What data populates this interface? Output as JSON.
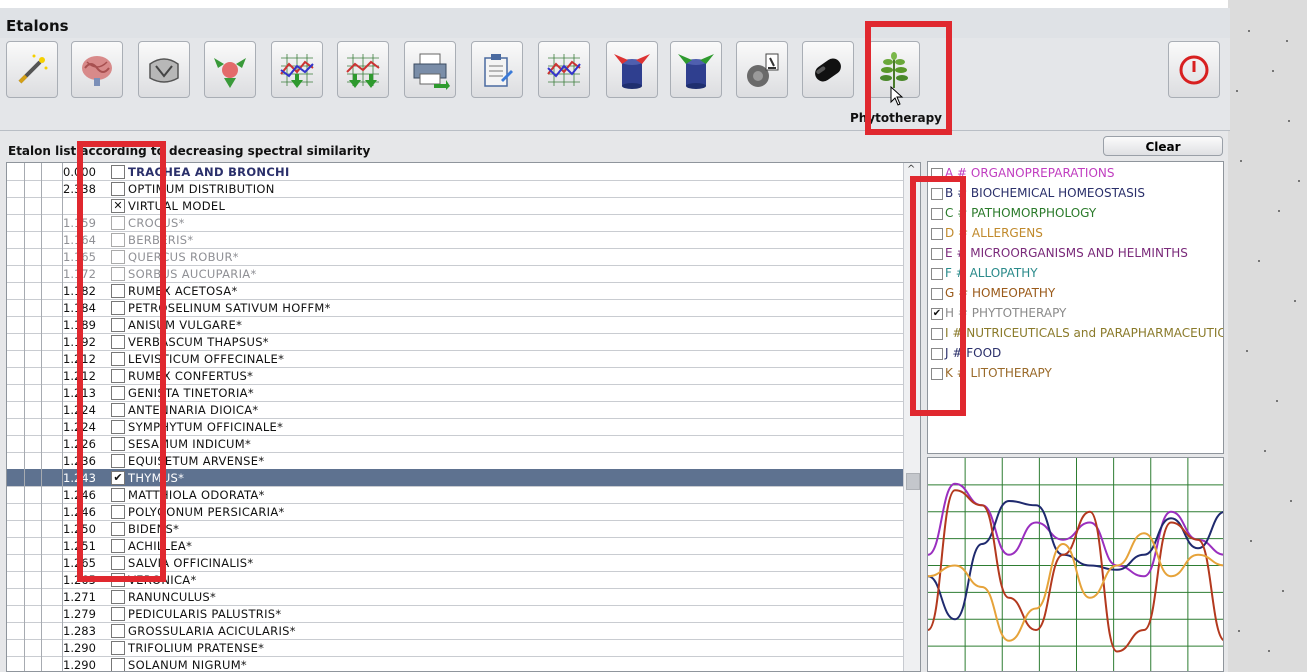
{
  "window": {
    "title": "Etalons"
  },
  "toolbar": {
    "buttons": [
      {
        "icon": "magic-wand-icon"
      },
      {
        "icon": "brain-icon"
      },
      {
        "icon": "torso-icon"
      },
      {
        "icon": "merge-arrows-icon"
      },
      {
        "icon": "chart-up-icon"
      },
      {
        "icon": "chart-double-up-icon"
      },
      {
        "icon": "printer-icon"
      },
      {
        "icon": "clipboard-icon"
      },
      {
        "icon": "spectrum-chart-icon"
      },
      {
        "icon": "red-cylinder-icon"
      },
      {
        "icon": "green-cylinder-icon"
      },
      {
        "icon": "microscope-icon"
      },
      {
        "icon": "black-capsule-icon"
      },
      {
        "icon": "plant-icon"
      }
    ],
    "phytotherapy_label": "Phytotherapy",
    "power_icon": "power-icon"
  },
  "list": {
    "header": "Etalon list according to decreasing spectral similarity",
    "rows": [
      {
        "value": "0.000",
        "name": "TRACHEA AND BRONCHI",
        "checked": false,
        "style": "first"
      },
      {
        "value": "2.338",
        "name": "OPTIMUM DISTRIBUTION",
        "checked": false,
        "style": "normal"
      },
      {
        "value": "",
        "name": "VIRTUAL MODEL",
        "checked": true,
        "mark": "✕",
        "style": "normal"
      },
      {
        "value": "1.159",
        "name": "CROCUS*",
        "checked": false,
        "style": "grey"
      },
      {
        "value": "1.164",
        "name": "BERBERIS*",
        "checked": false,
        "style": "grey"
      },
      {
        "value": "1.165",
        "name": "QUERCUS ROBUR*",
        "checked": false,
        "style": "grey"
      },
      {
        "value": "1.172",
        "name": "SORBUS AUCUPARIA*",
        "checked": false,
        "style": "grey"
      },
      {
        "value": "1.182",
        "name": "RUMEX ACETOSA*",
        "checked": false,
        "style": "normal"
      },
      {
        "value": "1.184",
        "name": "PETROSELINUM SATIVUM HOFFM*",
        "checked": false,
        "style": "normal"
      },
      {
        "value": "1.189",
        "name": "ANISUM VULGARE*",
        "checked": false,
        "style": "normal"
      },
      {
        "value": "1.192",
        "name": "VERBASCUM THAPSUS*",
        "checked": false,
        "style": "normal"
      },
      {
        "value": "1.212",
        "name": "LEVISTICUM OFFECINALE*",
        "checked": false,
        "style": "normal"
      },
      {
        "value": "1.212",
        "name": "RUMEX CONFERTUS*",
        "checked": false,
        "style": "normal"
      },
      {
        "value": "1.213",
        "name": "GENISTA TINETORIA*",
        "checked": false,
        "style": "normal"
      },
      {
        "value": "1.224",
        "name": "ANTENNARIA DIOICA*",
        "checked": false,
        "style": "normal"
      },
      {
        "value": "1.224",
        "name": "SYMPHYTUM OFFICINALE*",
        "checked": false,
        "style": "normal"
      },
      {
        "value": "1.226",
        "name": "SESAMUM INDICUM*",
        "checked": false,
        "style": "normal"
      },
      {
        "value": "1.236",
        "name": "EQUISETUM ARVENSE*",
        "checked": false,
        "style": "normal"
      },
      {
        "value": "1.243",
        "name": "THYMUS*",
        "checked": true,
        "mark": "✔",
        "style": "selected"
      },
      {
        "value": "1.246",
        "name": "MATTHIOLA ODORATA*",
        "checked": false,
        "style": "normal"
      },
      {
        "value": "1.246",
        "name": "POLYGONUM PERSICARIA*",
        "checked": false,
        "style": "normal"
      },
      {
        "value": "1.250",
        "name": "BIDENS*",
        "checked": false,
        "style": "normal"
      },
      {
        "value": "1.251",
        "name": "ACHILLEA*",
        "checked": false,
        "style": "normal"
      },
      {
        "value": "1.265",
        "name": "SALVIA OFFICINALIS*",
        "checked": false,
        "style": "normal"
      },
      {
        "value": "1.265",
        "name": "VERONICA*",
        "checked": false,
        "style": "normal"
      },
      {
        "value": "1.271",
        "name": "RANUNCULUS*",
        "checked": false,
        "style": "normal"
      },
      {
        "value": "1.279",
        "name": "PEDICULARIS PALUSTRIS*",
        "checked": false,
        "style": "normal"
      },
      {
        "value": "1.283",
        "name": "GROSSULARIA ACICULARIS*",
        "checked": false,
        "style": "normal"
      },
      {
        "value": "1.290",
        "name": "TRIFOLIUM PRATENSE*",
        "checked": false,
        "style": "normal"
      },
      {
        "value": "1.290",
        "name": "SOLANUM NIGRUM*",
        "checked": false,
        "style": "normal"
      }
    ]
  },
  "categories": {
    "clear_label": "Clear",
    "items": [
      {
        "text": "A # ORGANOPREPARATIONS",
        "color": "#c03ec0",
        "checked": false
      },
      {
        "text": "B # BIOCHEMICAL HOMEOSTASIS",
        "color": "#2a2f6a",
        "checked": false
      },
      {
        "text": "C # PATHOMORPHOLOGY",
        "color": "#2a7a2a",
        "checked": false
      },
      {
        "text": "D # ALLERGENS",
        "color": "#c0892b",
        "checked": false
      },
      {
        "text": "E # MICROORGANISMS AND HELMINTHS",
        "color": "#7a2a7a",
        "checked": false
      },
      {
        "text": "F # ALLOPATHY",
        "color": "#2a8a8a",
        "checked": false
      },
      {
        "text": "G # HOMEOPATHY",
        "color": "#9a5a1a",
        "checked": false
      },
      {
        "text": "H # PHYTOTHERAPY",
        "color": "#8a8a8a",
        "checked": true
      },
      {
        "text": "I # NUTRICEUTICALS and PARAPHARMACEUTICALS",
        "color": "#8a7a2a",
        "checked": false
      },
      {
        "text": "J # FOOD",
        "color": "#2a2f6a",
        "checked": false
      },
      {
        "text": "K # LITOTHERAPY",
        "color": "#9a6a2a",
        "checked": false
      }
    ]
  },
  "graph": {
    "grid_color": "#2e7d32",
    "series": [
      {
        "color": "#9a2fbf",
        "values": [
          0.55,
          0.88,
          0.78,
          0.55,
          0.7,
          0.62,
          0.7,
          0.5,
          0.45,
          0.75,
          0.62,
          0.55
        ]
      },
      {
        "color": "#1f2a6e",
        "values": [
          0.45,
          0.25,
          0.6,
          0.8,
          0.78,
          0.55,
          0.5,
          0.48,
          0.55,
          0.72,
          0.58,
          0.75
        ]
      },
      {
        "color": "#b3391e",
        "values": [
          0.2,
          0.85,
          0.78,
          0.35,
          0.2,
          0.55,
          0.75,
          0.1,
          0.2,
          0.7,
          0.62,
          0.15
        ]
      },
      {
        "color": "#e6a33a",
        "values": [
          0.45,
          0.5,
          0.4,
          0.15,
          0.3,
          0.6,
          0.35,
          0.5,
          0.65,
          0.45,
          0.55,
          0.5
        ]
      }
    ]
  }
}
